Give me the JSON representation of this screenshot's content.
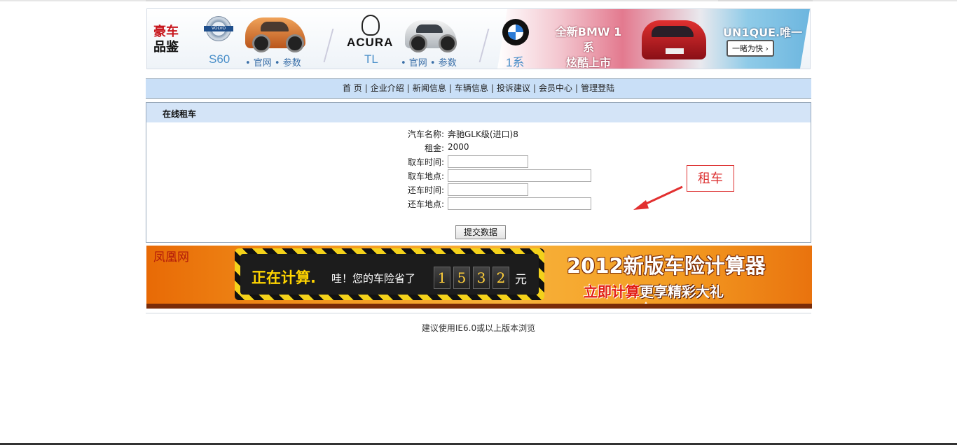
{
  "banner": {
    "section1_title_line1": "豪车",
    "section1_title_line2": "品鉴",
    "volvo_model": "S60",
    "volvo_links": "• 官网 • 参数",
    "acura_brand": "ACURA",
    "acura_model": "TL",
    "acura_links": "• 官网 • 参数",
    "bmw_brand": "BMW",
    "bmw_model": "1系",
    "bmw_slogan_line1": "全新BMW 1系",
    "bmw_slogan_line2": "炫酷上市",
    "unique_text": "UN1QUE.唯一",
    "go_button": "一睹为快 ›"
  },
  "nav": {
    "items": [
      {
        "label": "首 页"
      },
      {
        "label": "企业介绍"
      },
      {
        "label": "新闻信息"
      },
      {
        "label": "车辆信息"
      },
      {
        "label": "投诉建议"
      },
      {
        "label": "会员中心"
      },
      {
        "label": "管理登陆"
      }
    ],
    "separator": "|"
  },
  "panel": {
    "title": "在线租车",
    "car_name_label": "汽车名称:",
    "car_name_value": "奔驰GLK级(进口)8",
    "rent_label": "租金:",
    "rent_value": "2000",
    "pickup_time_label": "取车时间:",
    "pickup_time_value": "",
    "pickup_place_label": "取车地点:",
    "pickup_place_value": "",
    "return_time_label": "还车时间:",
    "return_time_value": "",
    "return_place_label": "还车地点:",
    "return_place_value": "",
    "submit_label": "提交数据"
  },
  "annotation": {
    "text": "租车",
    "color": "#dd3333"
  },
  "insurance_ad": {
    "site_name": "凤凰网",
    "calc_title": "正在计算.",
    "calc_message": "哇！您的车险省了",
    "digits": [
      "1",
      "5",
      "3",
      "2"
    ],
    "unit": "元",
    "headline": "2012新版车险计算器",
    "sub_red": "立即计算",
    "sub_rest": "更享精彩大礼"
  },
  "footer": {
    "text": "建议使用IE6.0或以上版本浏览"
  }
}
